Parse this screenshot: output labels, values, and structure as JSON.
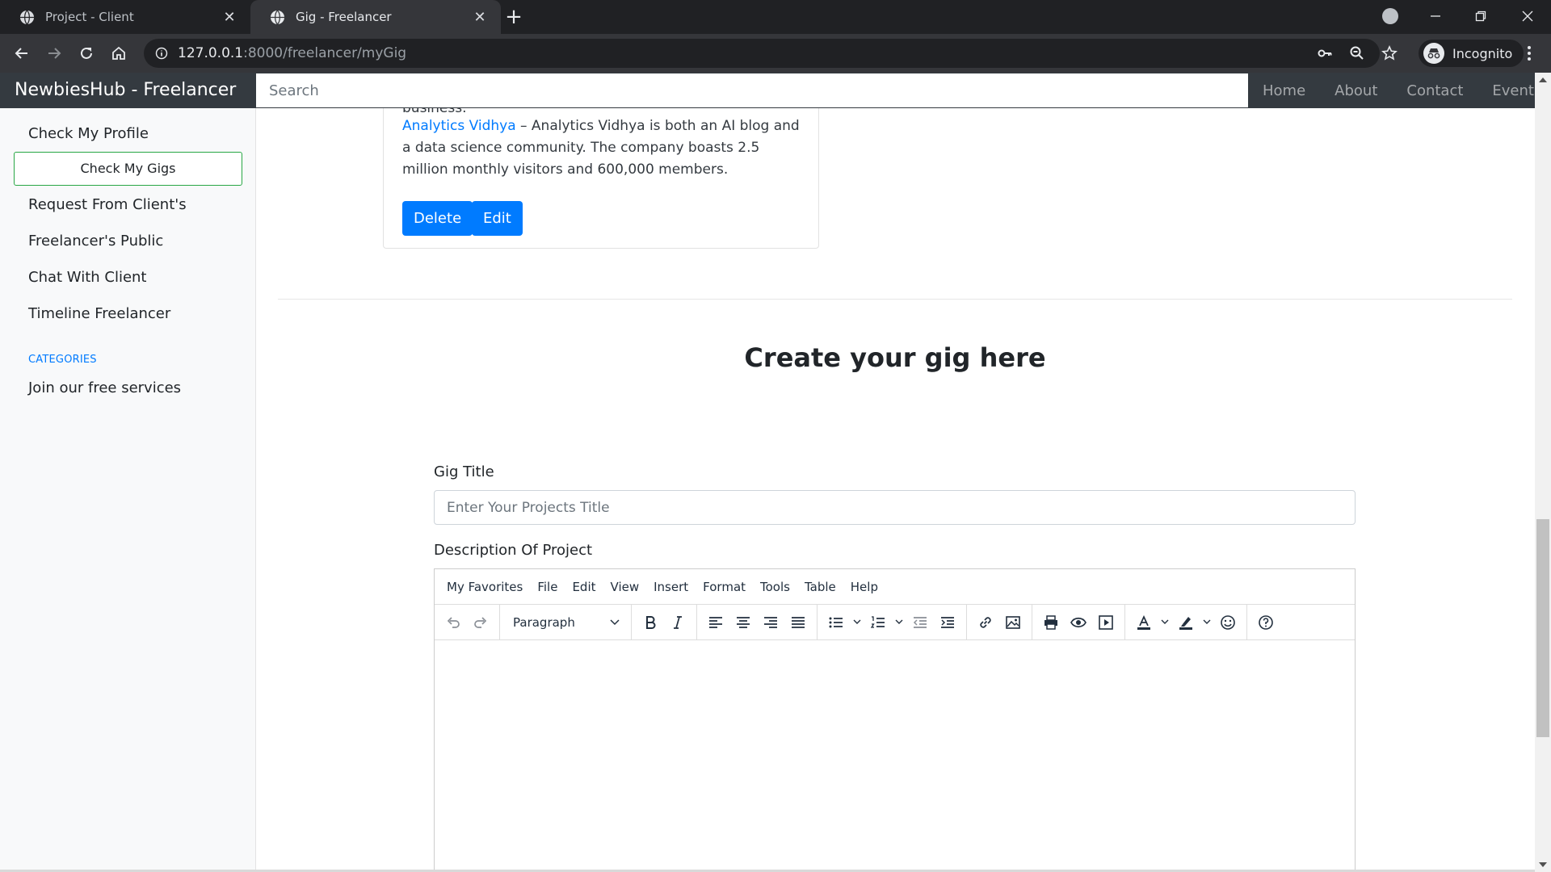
{
  "browser": {
    "tabs": [
      {
        "title": "Project - Client"
      },
      {
        "title": "Gig - Freelancer"
      }
    ],
    "url_host": "127.0.0.1",
    "url_rest": ":8000/freelancer/myGig",
    "profile_label": "Incognito"
  },
  "navbar": {
    "brand": "NewbiesHub - Freelancer",
    "search_placeholder": "Search",
    "links": [
      "Home",
      "About",
      "Contact",
      "Events"
    ]
  },
  "sidebar": {
    "items": [
      "Check My Profile",
      "Check My Gigs",
      "Request From Client's",
      "Freelancer's Public",
      "Chat With Client",
      "Timeline Freelancer"
    ],
    "categories_heading": "CATEGORIES",
    "categories_items": [
      "Join our free services"
    ]
  },
  "gig_card": {
    "partial_line": "business.",
    "link_text": "Analytics Vidhya",
    "body_text": " – Analytics Vidhya is both an AI blog and a data science community. The company boasts 2.5 million monthly visitors and 600,000 members.",
    "delete_label": "Delete",
    "edit_label": "Edit"
  },
  "create_form": {
    "heading": "Create your gig here",
    "title_label": "Gig Title",
    "title_placeholder": "Enter Your Projects Title",
    "description_label": "Description Of Project"
  },
  "editor": {
    "menus": [
      "My Favorites",
      "File",
      "Edit",
      "View",
      "Insert",
      "Format",
      "Tools",
      "Table",
      "Help"
    ],
    "block_format": "Paragraph"
  },
  "colors": {
    "primary": "#007bff",
    "active_border": "#28a745",
    "navbar_bg": "#343a40"
  }
}
